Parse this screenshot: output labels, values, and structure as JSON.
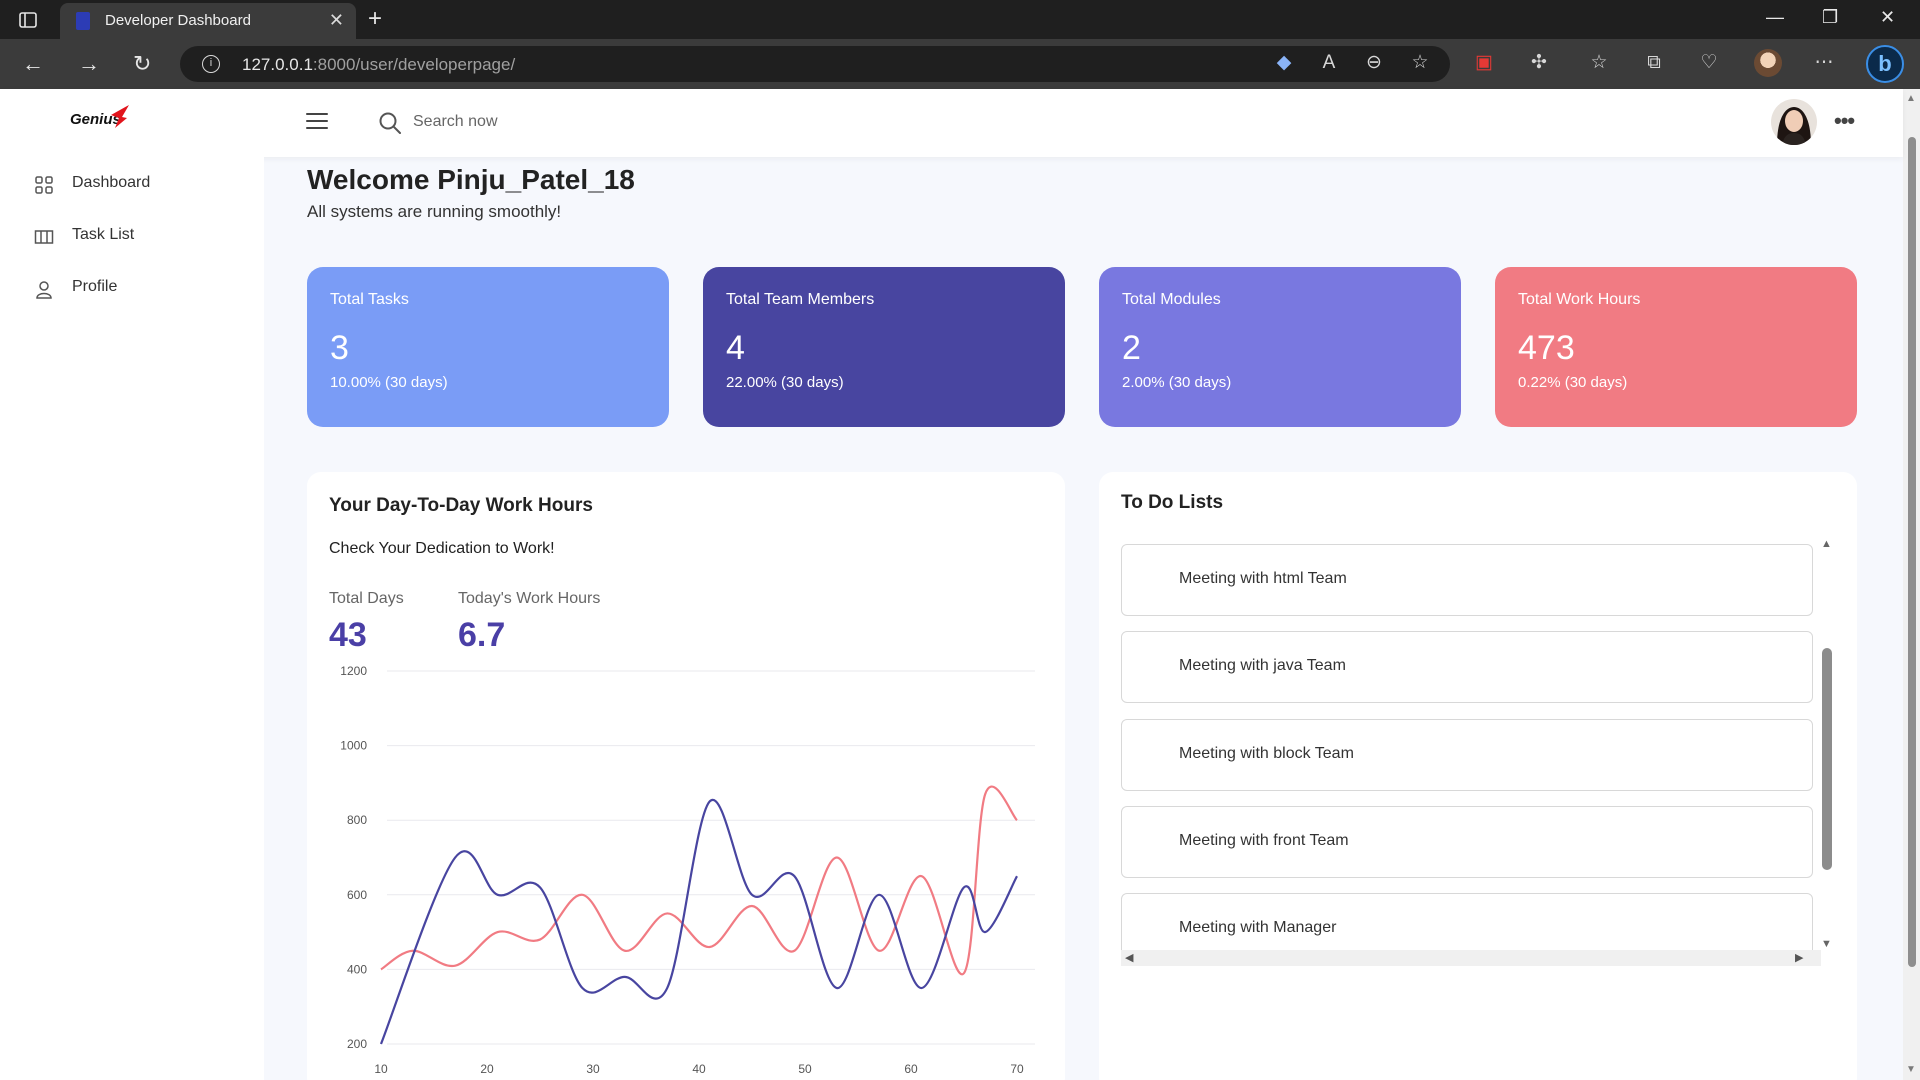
{
  "browser": {
    "tab_title": "Developer Dashboard",
    "url_host": "127.0.0.1",
    "url_path": ":8000/user/developerpage/"
  },
  "header": {
    "logo_text": "Genius",
    "search_placeholder": "Search now"
  },
  "sidebar": {
    "items": [
      {
        "label": "Dashboard",
        "icon": "grid-icon"
      },
      {
        "label": "Task List",
        "icon": "columns-icon"
      },
      {
        "label": "Profile",
        "icon": "user-icon"
      }
    ]
  },
  "welcome": {
    "title": "Welcome Pinju_Patel_18",
    "subtitle": "All systems are running smoothly!"
  },
  "stats": [
    {
      "title": "Total Tasks",
      "value": "3",
      "change": "10.00% (30 days)",
      "color": "#7a9cf6"
    },
    {
      "title": "Total Team Members",
      "value": "4",
      "change": "22.00% (30 days)",
      "color": "#4845a0"
    },
    {
      "title": "Total Modules",
      "value": "2",
      "change": "2.00% (30 days)",
      "color": "#7978e0"
    },
    {
      "title": "Total Work Hours",
      "value": "473",
      "change": "0.22% (30 days)",
      "color": "#f17b83"
    }
  ],
  "work_hours": {
    "title": "Your Day-To-Day Work Hours",
    "subtitle": "Check Your Dedication to Work!",
    "total_days_label": "Total Days",
    "total_days_value": "43",
    "today_label": "Today's Work Hours",
    "today_value": "6.7"
  },
  "chart_data": {
    "type": "line",
    "title": "",
    "xlabel": "",
    "ylabel": "",
    "xlim": [
      10,
      70
    ],
    "ylim": [
      200,
      1200
    ],
    "x_ticks": [
      10,
      20,
      30,
      40,
      50,
      60,
      70
    ],
    "y_ticks": [
      200,
      400,
      600,
      800,
      1000,
      1200
    ],
    "grid": true,
    "series": [
      {
        "color": "#4845a0",
        "x": [
          10,
          17,
          21,
          25,
          29,
          33,
          37,
          41,
          45,
          49,
          53,
          57,
          61,
          65,
          67,
          70
        ],
        "y": [
          200,
          700,
          600,
          620,
          350,
          380,
          350,
          850,
          600,
          650,
          350,
          600,
          350,
          620,
          500,
          650
        ]
      },
      {
        "color": "#f17b83",
        "x": [
          10,
          13,
          17,
          21,
          25,
          29,
          33,
          37,
          41,
          45,
          49,
          53,
          57,
          61,
          65,
          67,
          70
        ],
        "y": [
          400,
          450,
          410,
          500,
          480,
          600,
          450,
          550,
          460,
          570,
          450,
          700,
          450,
          650,
          390,
          870,
          800
        ]
      }
    ]
  },
  "todo": {
    "title": "To Do Lists",
    "items": [
      "Meeting with html Team",
      "Meeting with java Team",
      "Meeting with block Team",
      "Meeting with front Team",
      "Meeting with Manager"
    ]
  }
}
